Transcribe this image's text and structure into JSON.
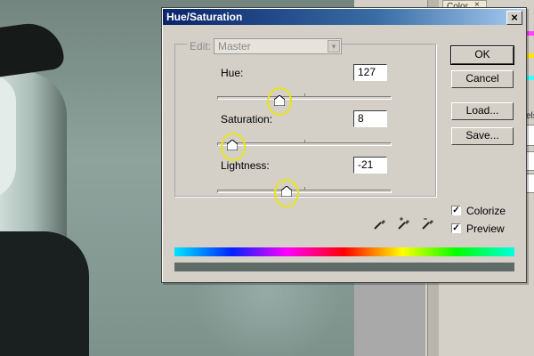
{
  "background": {
    "right_panel": {
      "color_tab": "Color",
      "color_tab_close": "×",
      "side_value": "els"
    }
  },
  "dialog": {
    "title": "Hue/Saturation",
    "close": "×",
    "edit": {
      "label": "Edit:",
      "value": "Master",
      "arrow": "▾"
    },
    "hue": {
      "label": "Hue:",
      "value": "127"
    },
    "saturation": {
      "label": "Saturation:",
      "value": "8"
    },
    "lightness": {
      "label": "Lightness:",
      "value": "-21"
    },
    "buttons": {
      "ok": "OK",
      "cancel": "Cancel",
      "load": "Load...",
      "save": "Save..."
    },
    "colorize": {
      "label": "Colorize",
      "checked": true,
      "mark": "✓"
    },
    "preview": {
      "label": "Preview",
      "checked": true,
      "mark": "✓"
    },
    "eyedroppers": [
      "eyedropper-icon",
      "eyedropper-plus-icon",
      "eyedropper-minus-icon"
    ],
    "result_color": "#5f6b66",
    "highlight_color": "#e8e41a"
  }
}
